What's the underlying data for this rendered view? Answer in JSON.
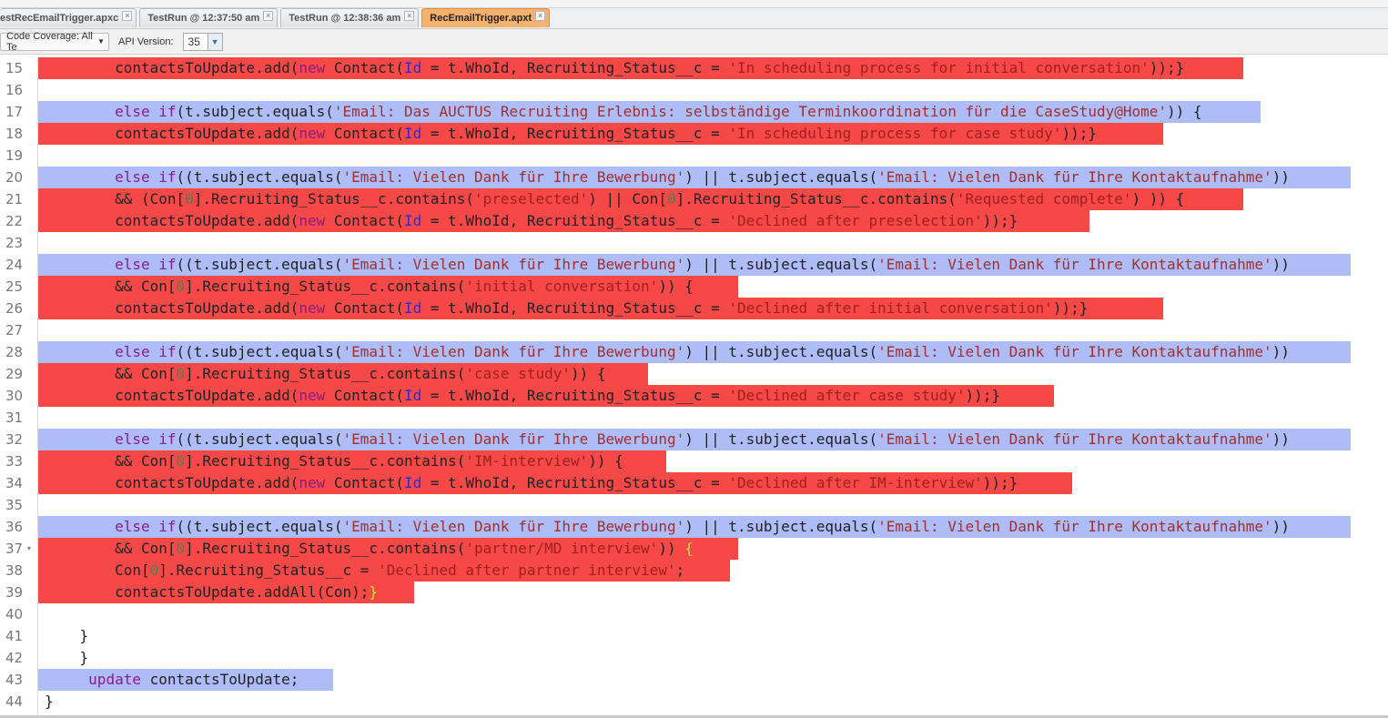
{
  "tabs": [
    {
      "label": "estRecEmailTrigger.apxc",
      "active": false
    },
    {
      "label": "TestRun @ 12:37:50 am",
      "active": false
    },
    {
      "label": "TestRun @ 12:38:36 am",
      "active": false
    },
    {
      "label": "RecEmailTrigger.apxt",
      "active": true
    }
  ],
  "close_glyph": "×",
  "toolbar": {
    "coverage": "Code Coverage: All Te",
    "api_label": "API Version:",
    "api_value": "35"
  },
  "lines": [
    {
      "n": "15",
      "cov": "red",
      "t": [
        [
          "p",
          "        contactsToUpdate.add("
        ],
        [
          "k",
          "new"
        ],
        [
          "p",
          " Contact("
        ],
        [
          "i",
          "Id"
        ],
        [
          "p",
          " = t.WhoId, Recruiting_Status__c = "
        ],
        [
          "s",
          "'In scheduling process for initial conversation'"
        ],
        [
          "p",
          "));}"
        ]
      ]
    },
    {
      "n": "16",
      "cov": "",
      "t": []
    },
    {
      "n": "17",
      "cov": "blue",
      "t": [
        [
          "p",
          "        "
        ],
        [
          "k",
          "else if"
        ],
        [
          "p",
          "(t.subject.equals("
        ],
        [
          "s",
          "'Email: Das AUCTUS Recruiting Erlebnis: selbständige Terminkoordination für die CaseStudy@Home'"
        ],
        [
          "p",
          ")) {"
        ]
      ]
    },
    {
      "n": "18",
      "cov": "red",
      "t": [
        [
          "p",
          "        contactsToUpdate.add("
        ],
        [
          "k",
          "new"
        ],
        [
          "p",
          " Contact("
        ],
        [
          "i",
          "Id"
        ],
        [
          "p",
          " = t.WhoId, Recruiting_Status__c = "
        ],
        [
          "s",
          "'In scheduling process for case study'"
        ],
        [
          "p",
          "));}"
        ]
      ]
    },
    {
      "n": "19",
      "cov": "",
      "t": []
    },
    {
      "n": "20",
      "cov": "blue",
      "t": [
        [
          "p",
          "        "
        ],
        [
          "k",
          "else if"
        ],
        [
          "p",
          "((t.subject.equals("
        ],
        [
          "s",
          "'Email: Vielen Dank für Ihre Bewerbung'"
        ],
        [
          "p",
          ") || t.subject.equals("
        ],
        [
          "s",
          "'Email: Vielen Dank für Ihre Kontaktaufnahme'"
        ],
        [
          "p",
          "))"
        ]
      ]
    },
    {
      "n": "21",
      "cov": "red",
      "t": [
        [
          "p",
          "        && (Con["
        ],
        [
          "n",
          "0"
        ],
        [
          "p",
          "].Recruiting_Status__c.contains("
        ],
        [
          "s",
          "'preselected'"
        ],
        [
          "p",
          ") || Con["
        ],
        [
          "n",
          "0"
        ],
        [
          "p",
          "].Recruiting_Status__c.contains("
        ],
        [
          "s",
          "'Requested complete'"
        ],
        [
          "p",
          ") )) {"
        ]
      ]
    },
    {
      "n": "22",
      "cov": "red",
      "t": [
        [
          "p",
          "        contactsToUpdate.add("
        ],
        [
          "k",
          "new"
        ],
        [
          "p",
          " Contact("
        ],
        [
          "i",
          "Id"
        ],
        [
          "p",
          " = t.WhoId, Recruiting_Status__c = "
        ],
        [
          "s",
          "'Declined after preselection'"
        ],
        [
          "p",
          "));}"
        ]
      ]
    },
    {
      "n": "23",
      "cov": "",
      "t": []
    },
    {
      "n": "24",
      "cov": "blue",
      "t": [
        [
          "p",
          "        "
        ],
        [
          "k",
          "else if"
        ],
        [
          "p",
          "((t.subject.equals("
        ],
        [
          "s",
          "'Email: Vielen Dank für Ihre Bewerbung'"
        ],
        [
          "p",
          ") || t.subject.equals("
        ],
        [
          "s",
          "'Email: Vielen Dank für Ihre Kontaktaufnahme'"
        ],
        [
          "p",
          "))"
        ]
      ]
    },
    {
      "n": "25",
      "cov": "red",
      "t": [
        [
          "p",
          "        && Con["
        ],
        [
          "n",
          "0"
        ],
        [
          "p",
          "].Recruiting_Status__c.contains("
        ],
        [
          "s",
          "'initial conversation'"
        ],
        [
          "p",
          ")) {"
        ]
      ]
    },
    {
      "n": "26",
      "cov": "red",
      "t": [
        [
          "p",
          "        contactsToUpdate.add("
        ],
        [
          "k",
          "new"
        ],
        [
          "p",
          " Contact("
        ],
        [
          "i",
          "Id"
        ],
        [
          "p",
          " = t.WhoId, Recruiting_Status__c = "
        ],
        [
          "s",
          "'Declined after initial conversation'"
        ],
        [
          "p",
          "));}"
        ]
      ]
    },
    {
      "n": "27",
      "cov": "",
      "t": []
    },
    {
      "n": "28",
      "cov": "blue",
      "t": [
        [
          "p",
          "        "
        ],
        [
          "k",
          "else if"
        ],
        [
          "p",
          "((t.subject.equals("
        ],
        [
          "s",
          "'Email: Vielen Dank für Ihre Bewerbung'"
        ],
        [
          "p",
          ") || t.subject.equals("
        ],
        [
          "s",
          "'Email: Vielen Dank für Ihre Kontaktaufnahme'"
        ],
        [
          "p",
          "))"
        ]
      ]
    },
    {
      "n": "29",
      "cov": "red",
      "t": [
        [
          "p",
          "        && Con["
        ],
        [
          "n",
          "0"
        ],
        [
          "p",
          "].Recruiting_Status__c.contains("
        ],
        [
          "s",
          "'case study'"
        ],
        [
          "p",
          ")) {"
        ]
      ]
    },
    {
      "n": "30",
      "cov": "red",
      "t": [
        [
          "p",
          "        contactsToUpdate.add("
        ],
        [
          "k",
          "new"
        ],
        [
          "p",
          " Contact("
        ],
        [
          "i",
          "Id"
        ],
        [
          "p",
          " = t.WhoId, Recruiting_Status__c = "
        ],
        [
          "s",
          "'Declined after case study'"
        ],
        [
          "p",
          "));}"
        ]
      ]
    },
    {
      "n": "31",
      "cov": "",
      "t": []
    },
    {
      "n": "32",
      "cov": "blue",
      "t": [
        [
          "p",
          "        "
        ],
        [
          "k",
          "else if"
        ],
        [
          "p",
          "((t.subject.equals("
        ],
        [
          "s",
          "'Email: Vielen Dank für Ihre Bewerbung'"
        ],
        [
          "p",
          ") || t.subject.equals("
        ],
        [
          "s",
          "'Email: Vielen Dank für Ihre Kontaktaufnahme'"
        ],
        [
          "p",
          "))"
        ]
      ]
    },
    {
      "n": "33",
      "cov": "red",
      "t": [
        [
          "p",
          "        && Con["
        ],
        [
          "n",
          "0"
        ],
        [
          "p",
          "].Recruiting_Status__c.contains("
        ],
        [
          "s",
          "'IM-interview'"
        ],
        [
          "p",
          ")) {"
        ]
      ]
    },
    {
      "n": "34",
      "cov": "red",
      "t": [
        [
          "p",
          "        contactsToUpdate.add("
        ],
        [
          "k",
          "new"
        ],
        [
          "p",
          " Contact("
        ],
        [
          "i",
          "Id"
        ],
        [
          "p",
          " = t.WhoId, Recruiting_Status__c = "
        ],
        [
          "s",
          "'Declined after IM-interview'"
        ],
        [
          "p",
          "));}"
        ]
      ]
    },
    {
      "n": "35",
      "cov": "",
      "t": []
    },
    {
      "n": "36",
      "cov": "blue",
      "t": [
        [
          "p",
          "        "
        ],
        [
          "k",
          "else if"
        ],
        [
          "p",
          "((t.subject.equals("
        ],
        [
          "s",
          "'Email: Vielen Dank für Ihre Bewerbung'"
        ],
        [
          "p",
          ") || t.subject.equals("
        ],
        [
          "s",
          "'Email: Vielen Dank für Ihre Kontaktaufnahme'"
        ],
        [
          "p",
          "))"
        ]
      ]
    },
    {
      "n": "37",
      "fold": "▾",
      "cov": "red",
      "t": [
        [
          "p",
          "        && Con["
        ],
        [
          "n",
          "0"
        ],
        [
          "p",
          "].Recruiting_Status__c.contains("
        ],
        [
          "s",
          "'partner/MD interview'"
        ],
        [
          "p",
          ")) "
        ],
        [
          "b",
          "{"
        ]
      ]
    },
    {
      "n": "38",
      "cov": "red",
      "t": [
        [
          "p",
          "        Con["
        ],
        [
          "n",
          "0"
        ],
        [
          "p",
          "].Recruiting_Status__c = "
        ],
        [
          "s",
          "'Declined after partner interview'"
        ],
        [
          "p",
          ";"
        ]
      ]
    },
    {
      "n": "39",
      "cov": "red",
      "t": [
        [
          "p",
          "        contactsToUpdate.addAll(Con);"
        ],
        [
          "b",
          "}"
        ]
      ]
    },
    {
      "n": "40",
      "cov": "",
      "t": []
    },
    {
      "n": "41",
      "cov": "",
      "t": [
        [
          "p",
          "    }"
        ]
      ]
    },
    {
      "n": "42",
      "cov": "",
      "t": [
        [
          "p",
          "    }"
        ]
      ]
    },
    {
      "n": "43",
      "cov": "blue",
      "t": [
        [
          "p",
          "     "
        ],
        [
          "k",
          "update"
        ],
        [
          "p",
          " contactsToUpdate;"
        ]
      ]
    },
    {
      "n": "44",
      "cov": "",
      "t": [
        [
          "p",
          "}"
        ]
      ]
    }
  ]
}
